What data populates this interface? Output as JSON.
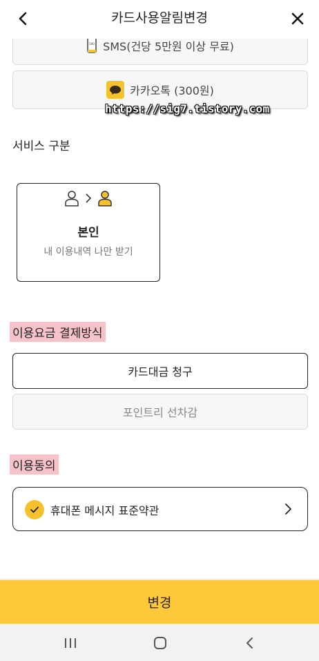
{
  "header": {
    "title": "카드사용알림변경",
    "back_icon": "back-arrow-icon",
    "close_icon": "close-icon"
  },
  "notify_options": {
    "sms_label": "SMS(건당 5만원 이상 무료)",
    "kakao_label": "카카오톡 (300원)"
  },
  "watermark": "https://sig7.tistory.com",
  "service": {
    "section_title": "서비스 구분",
    "card_name": "본인",
    "card_desc": "내 이용내역 나만 받기"
  },
  "payment": {
    "section_title": "이용요금 결제방식",
    "card_billing_label": "카드대금 청구",
    "point_deduct_label": "포인트리 선차감"
  },
  "agreement": {
    "section_title": "이용동의",
    "terms_label": "휴대폰 메시지 표준약관",
    "checked": true
  },
  "submit_label": "변경",
  "colors": {
    "accent": "#fdc839",
    "highlight": "#f6c3cb",
    "kakao_yellow": "#f5c22e"
  }
}
